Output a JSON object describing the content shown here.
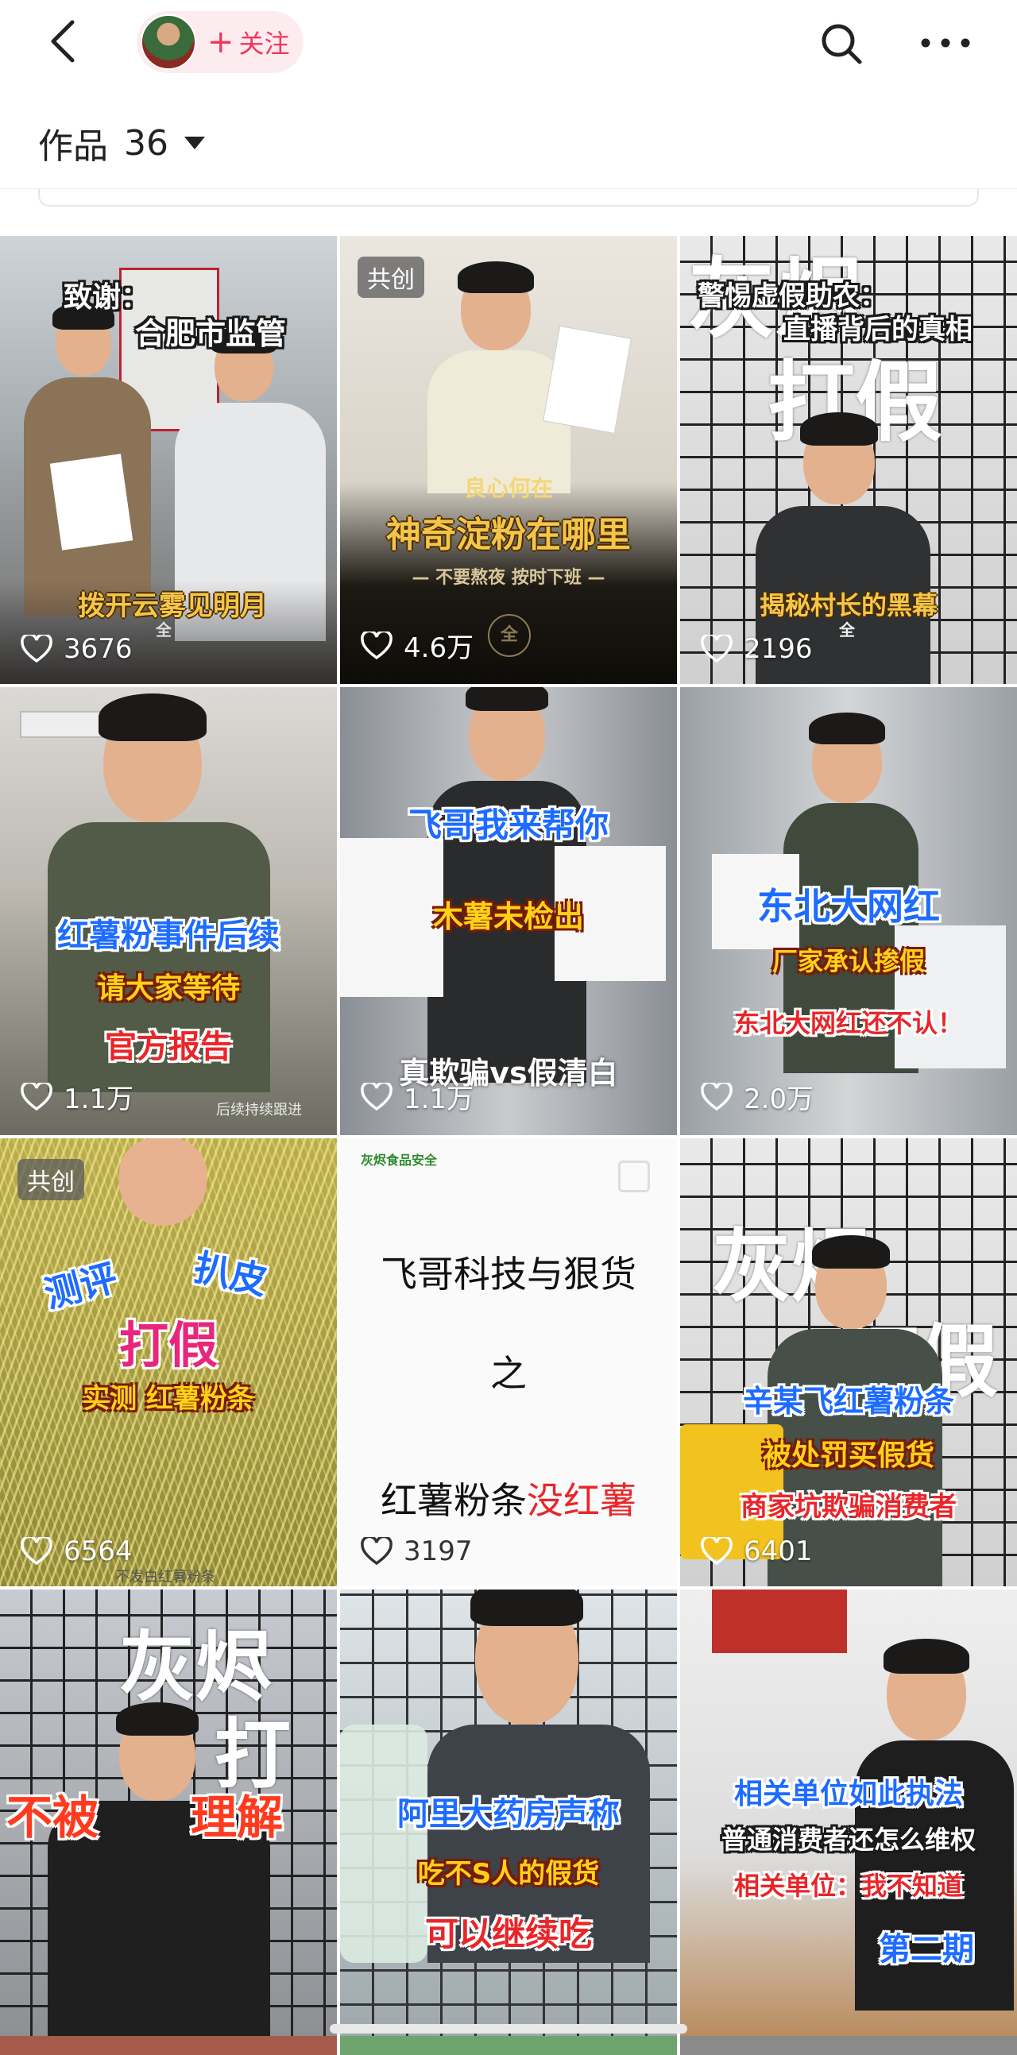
{
  "header": {
    "follow_label": "关注",
    "works_label": "作品",
    "works_count": "36"
  },
  "icons": [
    "back-icon",
    "search-icon",
    "more-icon",
    "heart-icon",
    "caret-down-icon"
  ],
  "colors": {
    "accent": "#f0365a",
    "follow_bg": "#fdecef"
  },
  "videos": [
    {
      "badge": "",
      "likes": "3676",
      "captions": [
        "致谢：",
        "合肥市监管",
        "拨开云雾见明月",
        "全"
      ]
    },
    {
      "badge": "共创",
      "likes": "4.6万",
      "captions": [
        "良心何在",
        "神奇淀粉在哪里",
        "— 不要熬夜 按时下班 —",
        "全"
      ]
    },
    {
      "badge": "",
      "likes": "2196",
      "captions": [
        "灰烬",
        "警惕虚假助农：",
        "直播背后的真相",
        "打假",
        "揭秘村长的黑幕",
        "全"
      ]
    },
    {
      "badge": "",
      "likes": "1.1万",
      "captions": [
        "红薯粉事件后续",
        "请大家等待",
        "官方报告",
        "后续持续跟进"
      ]
    },
    {
      "badge": "",
      "likes": "1.1万",
      "captions": [
        "飞哥我来帮你",
        "木薯未检出",
        "真欺骗vs假清白"
      ]
    },
    {
      "badge": "",
      "likes": "2.0万",
      "captions": [
        "东北大网红",
        "厂家承认掺假",
        "东北大网红还不认！"
      ]
    },
    {
      "badge": "共创",
      "likes": "6564",
      "captions": [
        "测评",
        "扒皮",
        "打假",
        "实测 红薯粉条",
        "不发白红薯粉条"
      ]
    },
    {
      "badge": "",
      "likes": "3197",
      "captions": [
        "灰烬食品安全",
        "飞哥科技与狠货",
        "之",
        "红薯粉条",
        "没红薯"
      ]
    },
    {
      "badge": "",
      "likes": "6401",
      "captions": [
        "灰烬",
        "打假",
        "辛某飞红薯粉条",
        "被处罚买假货",
        "商家坑欺骗消费者"
      ]
    },
    {
      "badge": "",
      "likes": "",
      "captions": [
        "灰烬",
        "打",
        "不被",
        "理解"
      ]
    },
    {
      "badge": "",
      "likes": "",
      "captions": [
        "阿里大药房声称",
        "吃不S人的假货",
        "可以继续吃"
      ]
    },
    {
      "badge": "",
      "likes": "",
      "captions": [
        "相关单位如此执法",
        "普通消费者还怎么维权",
        "相关单位：我不知道",
        "第二期"
      ]
    }
  ]
}
